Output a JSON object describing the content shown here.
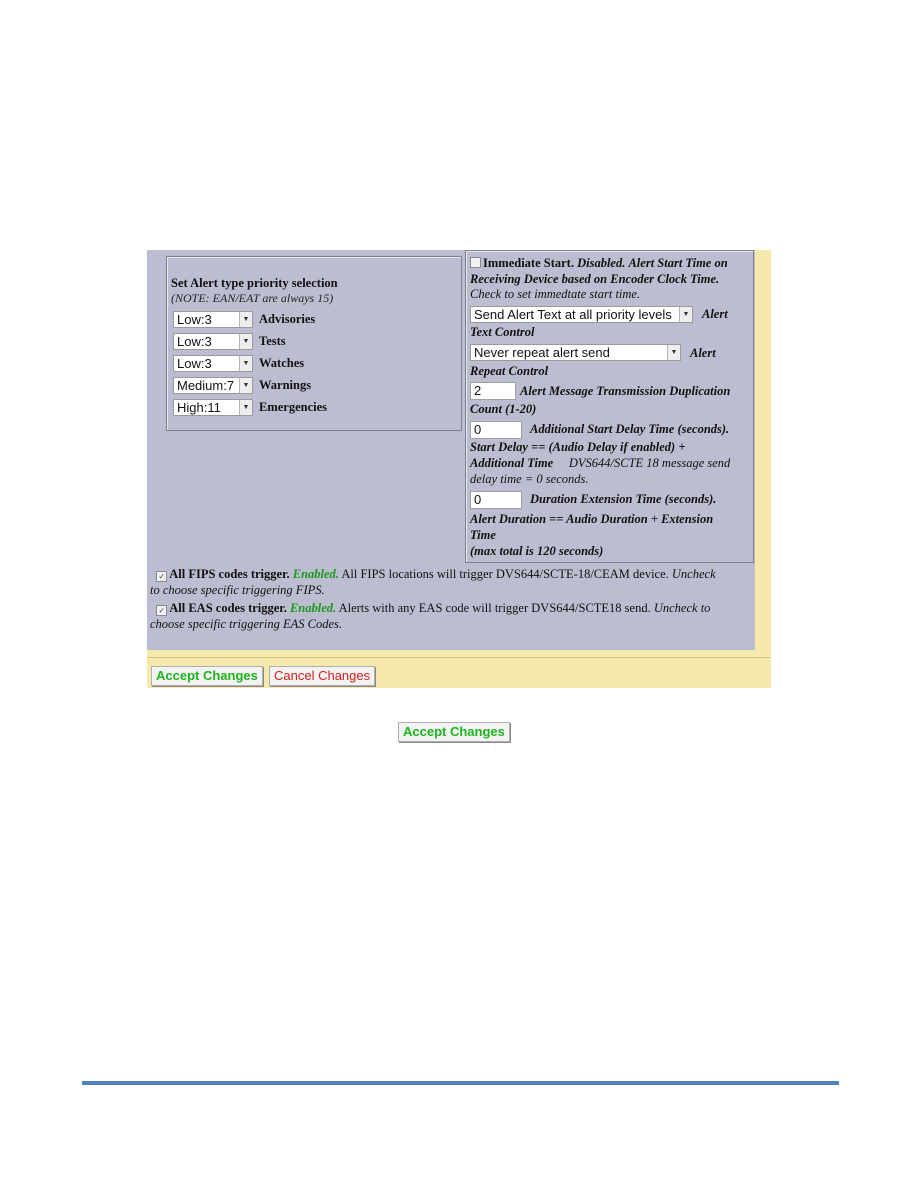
{
  "priority": {
    "title": "Set Alert type priority selection",
    "note": "(NOTE: EAN/EAT are always 15)",
    "rows": [
      {
        "value": "Low:3",
        "label": "Advisories"
      },
      {
        "value": "Low:3",
        "label": "Tests"
      },
      {
        "value": "Low:3",
        "label": "Watches"
      },
      {
        "value": "Medium:7",
        "label": "Warnings"
      },
      {
        "value": "High:11",
        "label": "Emergencies"
      }
    ]
  },
  "immediate_start": {
    "label": "Immediate Start.",
    "status": "Disabled.",
    "desc_bold": "Alert Start Time on Receiving Device based on Encoder Clock Time.",
    "hint": "Check to set immedtate start time.",
    "checked": false
  },
  "alert_text_control": {
    "value": "Send Alert Text at all priority levels",
    "label_1": "Alert",
    "label_2": "Text Control"
  },
  "alert_repeat_control": {
    "value": "Never repeat alert send",
    "label_1": "Alert",
    "label_2": "Repeat Control"
  },
  "duplication_count": {
    "value": "2",
    "label_1": "Alert Message Transmission Duplication",
    "label_2": "Count (1-20)"
  },
  "start_delay": {
    "value": "0",
    "label": "Additional Start Delay Time (seconds).",
    "formula_1": "Start Delay == (Audio Delay if enabled) +",
    "formula_2": "Additional Time",
    "info_1": "DVS644/SCTE 18 message send",
    "info_2": "delay time = 0 seconds."
  },
  "duration_extension": {
    "value": "0",
    "label": "Duration Extension Time (seconds).",
    "formula_1": "Alert Duration == Audio Duration + Extension",
    "formula_2": "Time",
    "max": "(max total is 120 seconds)"
  },
  "fips_trigger": {
    "checked": true,
    "label": "All FIPS codes trigger.",
    "status": "Enabled.",
    "desc": "All FIPS locations will trigger DVS644/SCTE-18/CEAM device.",
    "hint_1": "Uncheck",
    "hint_2": "to choose specific triggering FIPS."
  },
  "eas_trigger": {
    "checked": true,
    "label": "All EAS codes trigger.",
    "status": "Enabled.",
    "desc": "Alerts with any EAS code will trigger DVS644/SCTE18 send.",
    "hint_1": "Uncheck to",
    "hint_2": "choose specific triggering EAS Codes."
  },
  "buttons": {
    "accept": "Accept Changes",
    "cancel": "Cancel Changes",
    "accept_standalone": "Accept Changes"
  },
  "colors": {
    "panel_bg": "#bdbdd1",
    "frame_bg": "#f5eaab",
    "enabled_green": "#1a9a1a",
    "accept_green": "#1db41d",
    "cancel_red": "#d42020",
    "footer_rule": "#4f81bd"
  }
}
